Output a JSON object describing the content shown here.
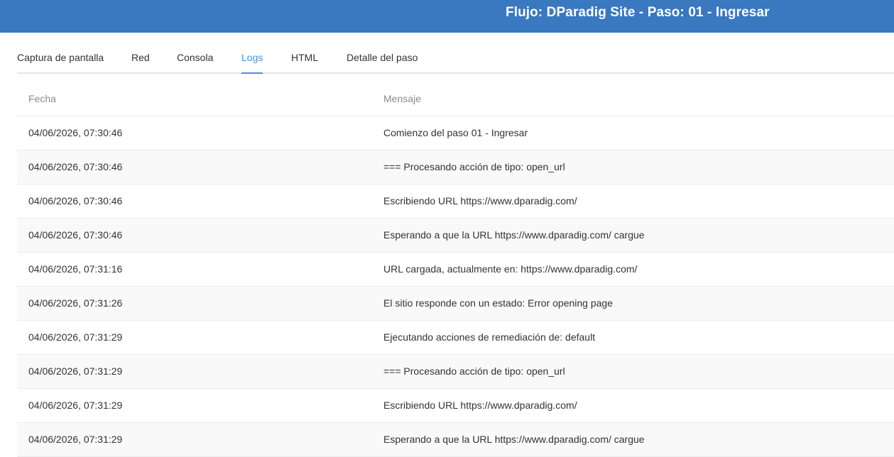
{
  "header": {
    "title": "Flujo: DParadig Site - Paso: 01 - Ingresar"
  },
  "tabs": [
    {
      "label": "Captura de pantalla"
    },
    {
      "label": "Red"
    },
    {
      "label": "Consola"
    },
    {
      "label": "Logs"
    },
    {
      "label": "HTML"
    },
    {
      "label": "Detalle del paso"
    }
  ],
  "active_tab": "Logs",
  "colors": {
    "header_bg": "#3a78bf",
    "accent": "#4a90e2"
  },
  "table": {
    "headers": {
      "date": "Fecha",
      "message": "Mensaje"
    },
    "rows": [
      {
        "date": "04/06/2026, 07:30:46",
        "message": "Comienzo del paso 01 - Ingresar"
      },
      {
        "date": "04/06/2026, 07:30:46",
        "message": "=== Procesando acción de tipo: open_url"
      },
      {
        "date": "04/06/2026, 07:30:46",
        "message": "Escribiendo URL https://www.dparadig.com/"
      },
      {
        "date": "04/06/2026, 07:30:46",
        "message": "Esperando a que la URL https://www.dparadig.com/ cargue"
      },
      {
        "date": "04/06/2026, 07:31:16",
        "message": "URL cargada, actualmente en: https://www.dparadig.com/"
      },
      {
        "date": "04/06/2026, 07:31:26",
        "message": "El sitio responde con un estado: Error opening page"
      },
      {
        "date": "04/06/2026, 07:31:29",
        "message": "Ejecutando acciones de remediación de: default"
      },
      {
        "date": "04/06/2026, 07:31:29",
        "message": "=== Procesando acción de tipo: open_url"
      },
      {
        "date": "04/06/2026, 07:31:29",
        "message": "Escribiendo URL https://www.dparadig.com/"
      },
      {
        "date": "04/06/2026, 07:31:29",
        "message": "Esperando a que la URL https://www.dparadig.com/ cargue"
      }
    ]
  }
}
